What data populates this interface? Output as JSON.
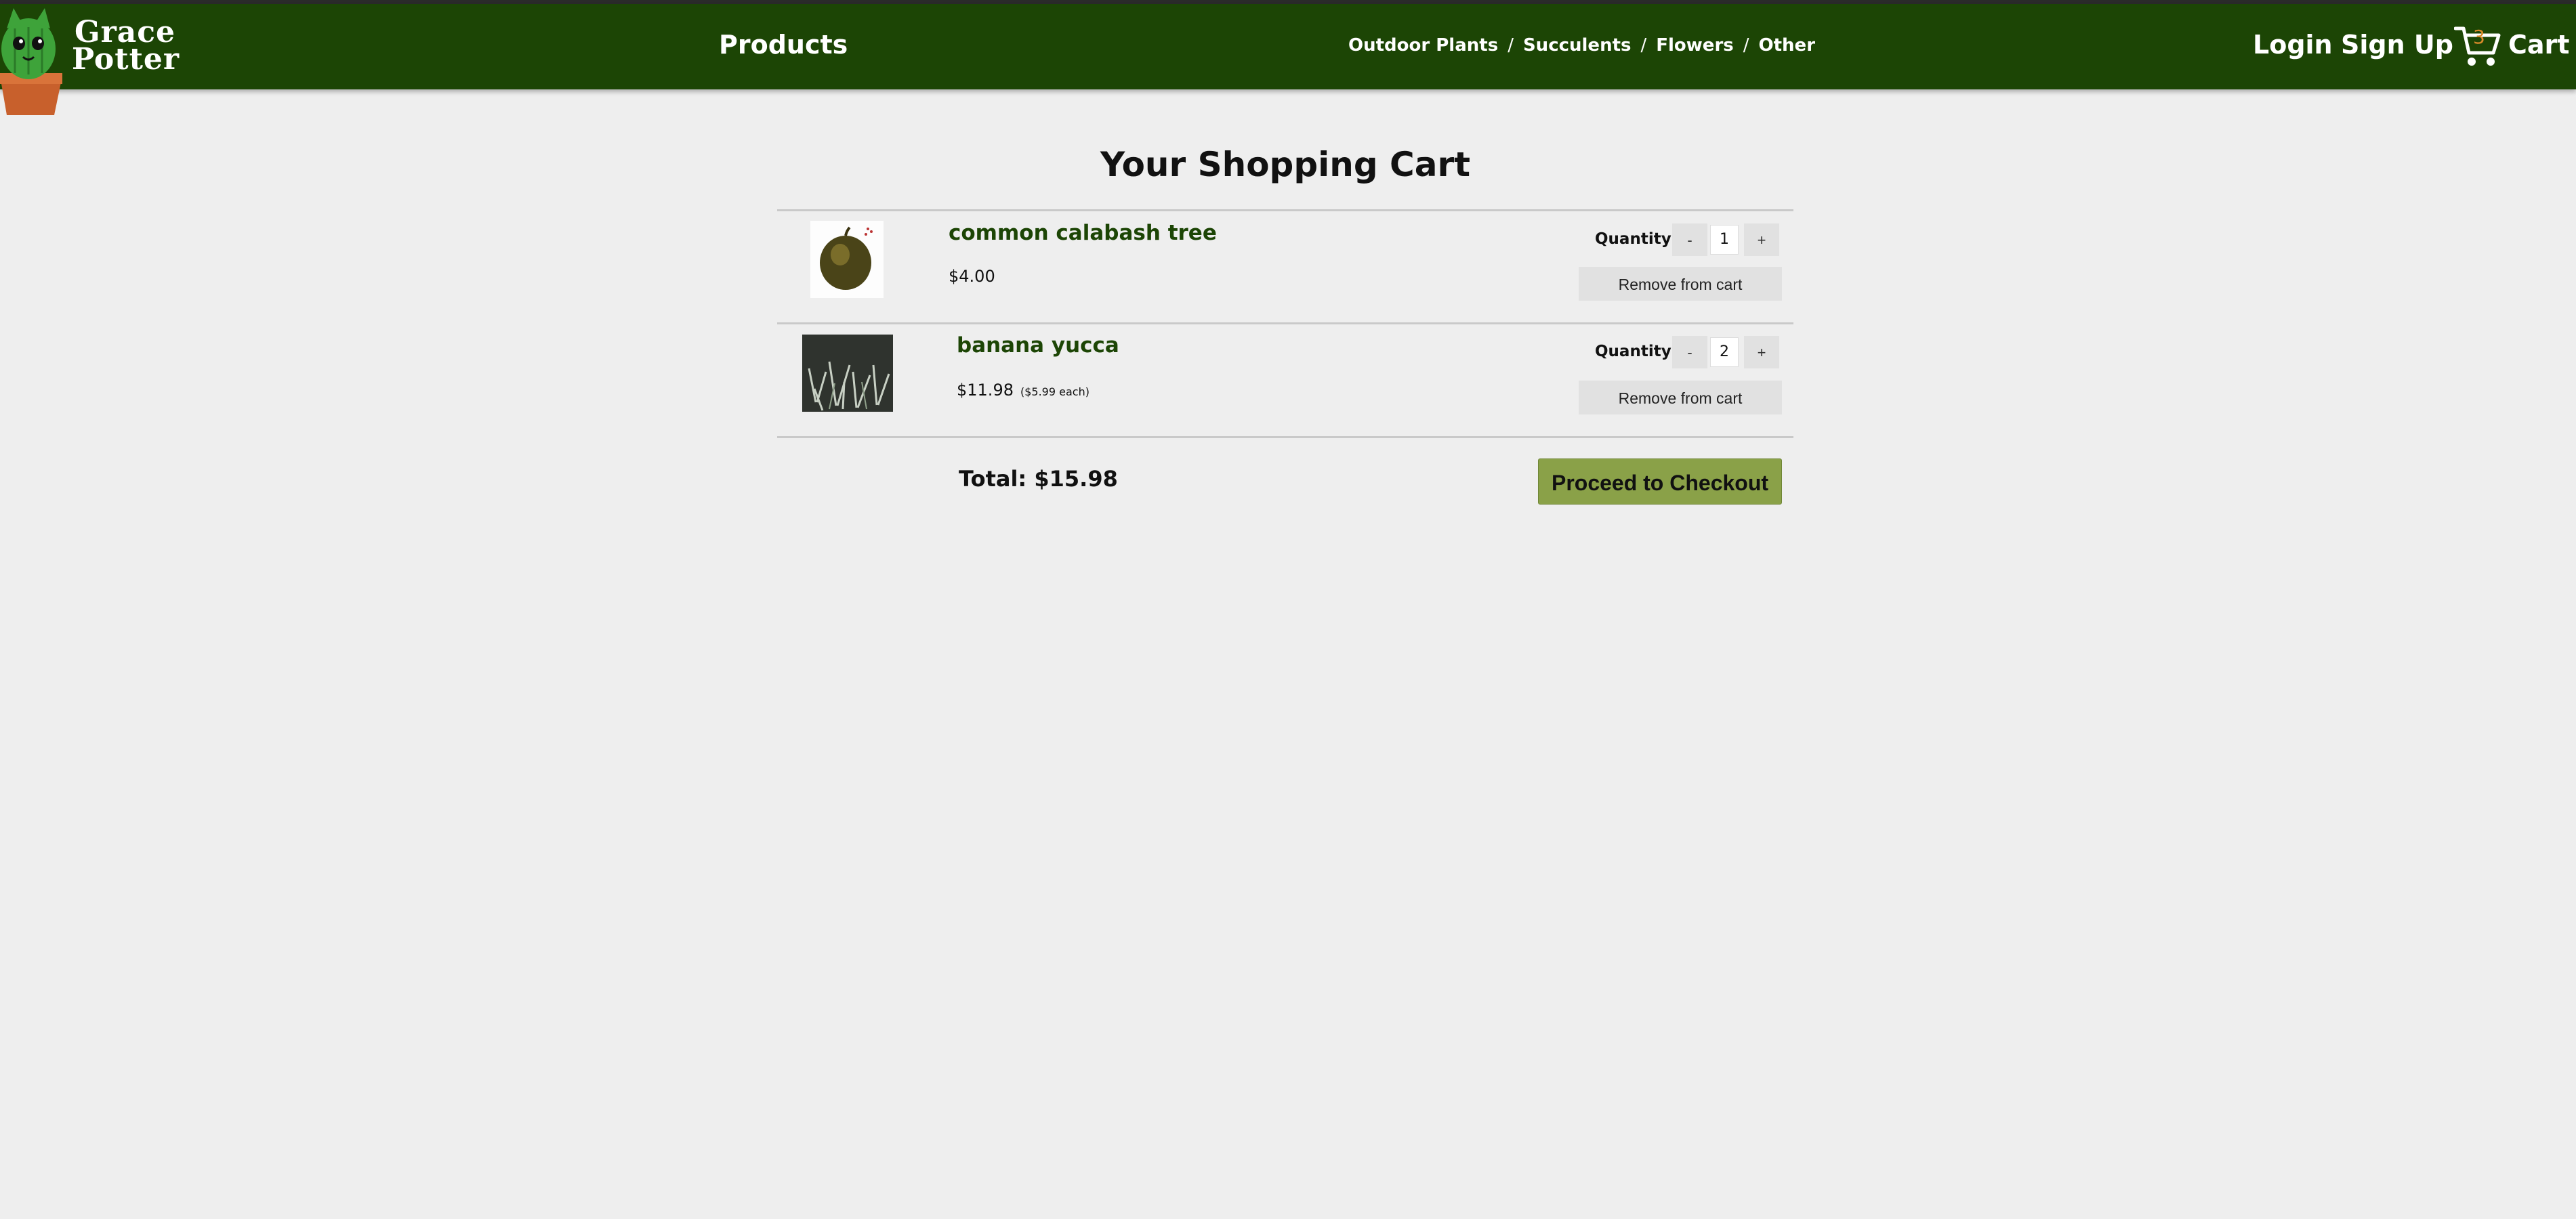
{
  "nav": {
    "brand_line1": "Grace",
    "brand_line2": "Potter",
    "products": "Products",
    "categories": [
      "Outdoor Plants",
      "Succulents",
      "Flowers",
      "Other"
    ],
    "separator": "/",
    "login": "Login",
    "signup": "Sign Up",
    "cart_count": "3",
    "cart": "Cart",
    "icons": [
      "cactus-mascot-logo",
      "shopping-cart-icon"
    ]
  },
  "cart": {
    "title": "Your Shopping Cart",
    "quantity_label": "Quantity",
    "minus": "-",
    "plus": "+",
    "remove_label": "Remove from cart",
    "items": [
      {
        "name": "common calabash tree",
        "price": "$4.00",
        "each": "",
        "quantity": "1"
      },
      {
        "name": "banana yucca",
        "price": "$11.98",
        "each": "($5.99 each)",
        "quantity": "2"
      }
    ],
    "total": "Total: $15.98",
    "checkout": "Proceed to Checkout"
  },
  "colors": {
    "nav_bg": "#1c4505",
    "accent_button": "#8aa148",
    "item_name": "#1c4505",
    "cart_count": "#d98a2a",
    "page_bg": "#eeeeee"
  }
}
